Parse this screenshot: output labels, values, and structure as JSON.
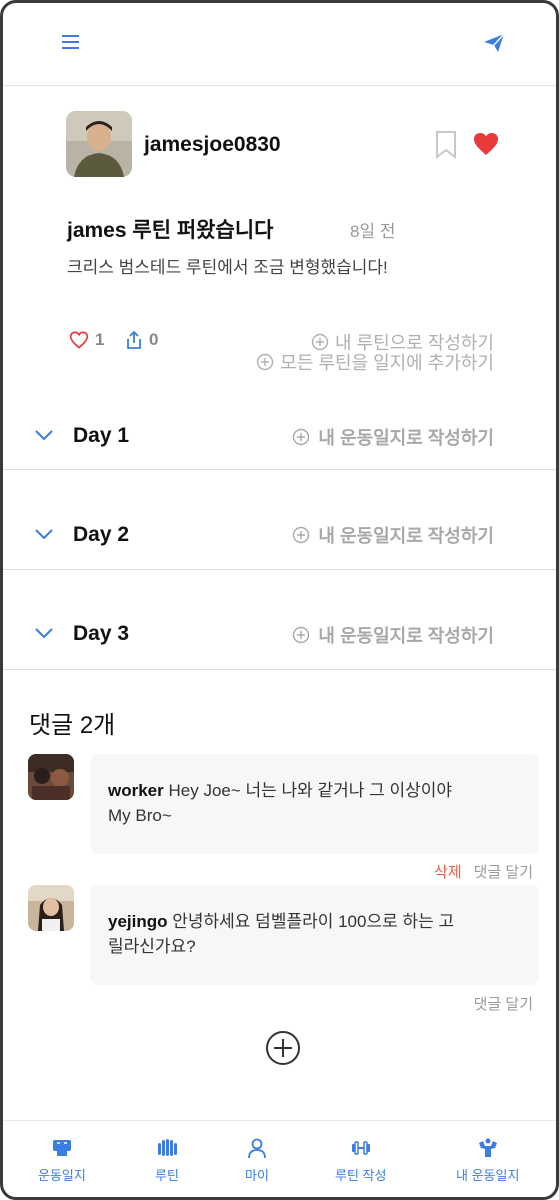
{
  "colors": {
    "accent": "#3b7de0",
    "heart": "#e8393b",
    "delete": "#e85c4a",
    "muted": "#b0b0b0"
  },
  "header": {
    "menu_icon": "hamburger-menu-icon",
    "send_icon": "paper-plane-icon"
  },
  "post": {
    "username": "jamesjoe0830",
    "title": "james 루틴 퍼왔습니다",
    "time_ago": "8일 전",
    "description": "크리스 범스테드 루틴에서 조금 변형했습니다!",
    "like_count": "1",
    "share_count": "0",
    "write_mine_label": "내 루틴으로 작성하기",
    "add_all_label": "모든 루틴을 일지에 추가하기",
    "bookmarked": false,
    "liked": true
  },
  "days": [
    {
      "label": "Day 1",
      "action": "내 운동일지로 작성하기"
    },
    {
      "label": "Day 2",
      "action": "내 운동일지로 작성하기"
    },
    {
      "label": "Day 3",
      "action": "내 운동일지로 작성하기"
    }
  ],
  "comments": {
    "title": "댓글 2개",
    "items": [
      {
        "author": "worker",
        "text": "Hey Joe~ 너는 나와 같거나 그 이상이야",
        "text2": "My Bro~",
        "delete_label": "삭제",
        "reply_label": "댓글 달기"
      },
      {
        "author": "yejingo",
        "text": "안녕하세요 덤벨플라이 100으로 하는 고",
        "text2": "릴라신가요?",
        "reply_label": "댓글 달기"
      }
    ]
  },
  "bottom_nav": [
    {
      "label": "운동일지",
      "icon": "workout-log-icon"
    },
    {
      "label": "루틴",
      "icon": "routine-icon"
    },
    {
      "label": "마이",
      "icon": "person-icon"
    },
    {
      "label": "루틴 작성",
      "icon": "dumbbell-icon"
    },
    {
      "label": "내 운동일지",
      "icon": "muscle-icon"
    }
  ]
}
